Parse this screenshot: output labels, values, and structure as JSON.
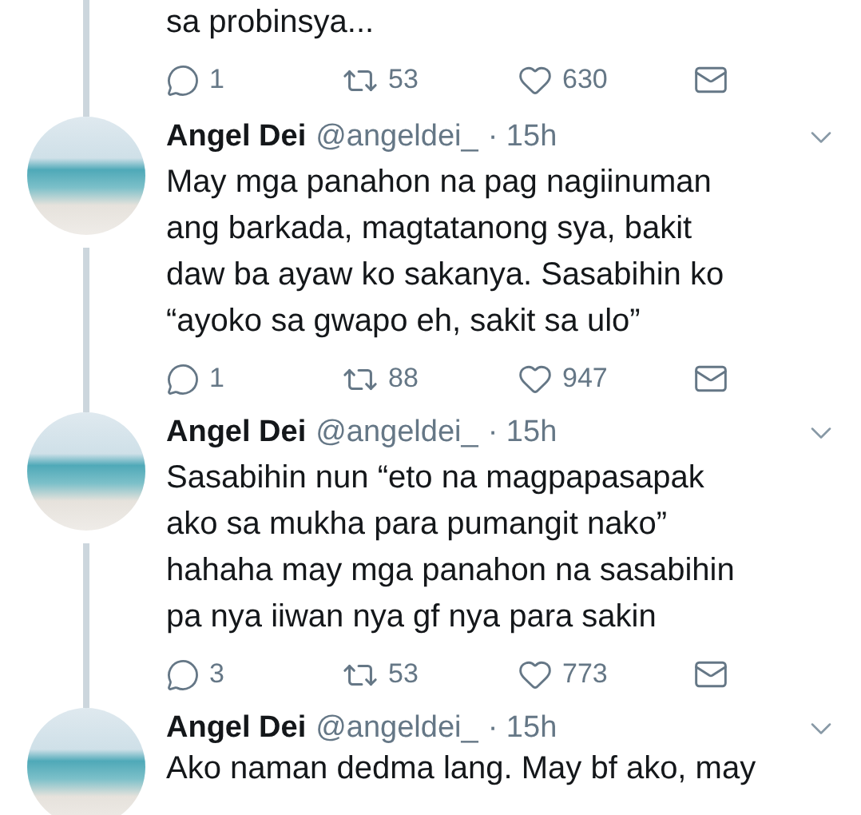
{
  "tweets": [
    {
      "kind": "partial",
      "text": "sa probinsya...",
      "replies": "1",
      "retweets": "53",
      "likes": "630"
    },
    {
      "kind": "full",
      "name": "Angel Dei",
      "handle": "@angeldei_",
      "time": "· 15h",
      "text": "May mga panahon na pag nagiinuman\nang barkada, magtatanong sya, bakit\ndaw ba ayaw ko sakanya. Sasabihin ko\n“ayoko sa gwapo eh, sakit sa ulo”",
      "replies": "1",
      "retweets": "88",
      "likes": "947"
    },
    {
      "kind": "full",
      "name": "Angel Dei",
      "handle": "@angeldei_",
      "time": "· 15h",
      "text": "Sasabihin nun “eto na magpapasapak\nako sa mukha para pumangit nako”\nhahaha may mga panahon na sasabihin\npa nya iiwan nya gf nya para sakin",
      "replies": "3",
      "retweets": "53",
      "likes": "773"
    },
    {
      "kind": "cut",
      "name": "Angel Dei",
      "handle": "@angeldei_",
      "time": "· 15h",
      "text": "Ako naman dedma lang. May bf ako, may"
    }
  ]
}
